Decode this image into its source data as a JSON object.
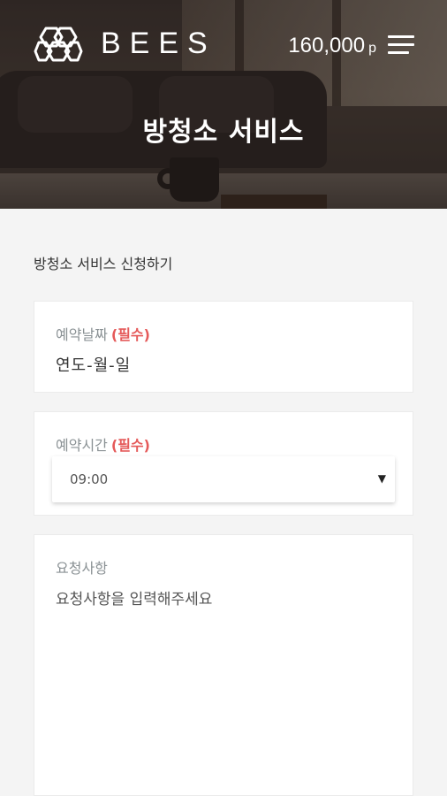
{
  "header": {
    "brand": "BEES",
    "points_value": "160,000",
    "points_unit": "p",
    "icons": [
      "hexagon-logo-icon",
      "menu-icon"
    ]
  },
  "hero": {
    "title": "방청소 서비스"
  },
  "form": {
    "section_title": "방청소 서비스 신청하기",
    "date": {
      "label": "예약날짜",
      "required_tag": "(필수)",
      "placeholder": "연도-월-일"
    },
    "time": {
      "label": "예약시간",
      "required_tag": "(필수)",
      "selected": "09:00",
      "caret": "▼"
    },
    "request": {
      "label": "요청사항",
      "placeholder": "요청사항을 입력해주세요"
    }
  }
}
